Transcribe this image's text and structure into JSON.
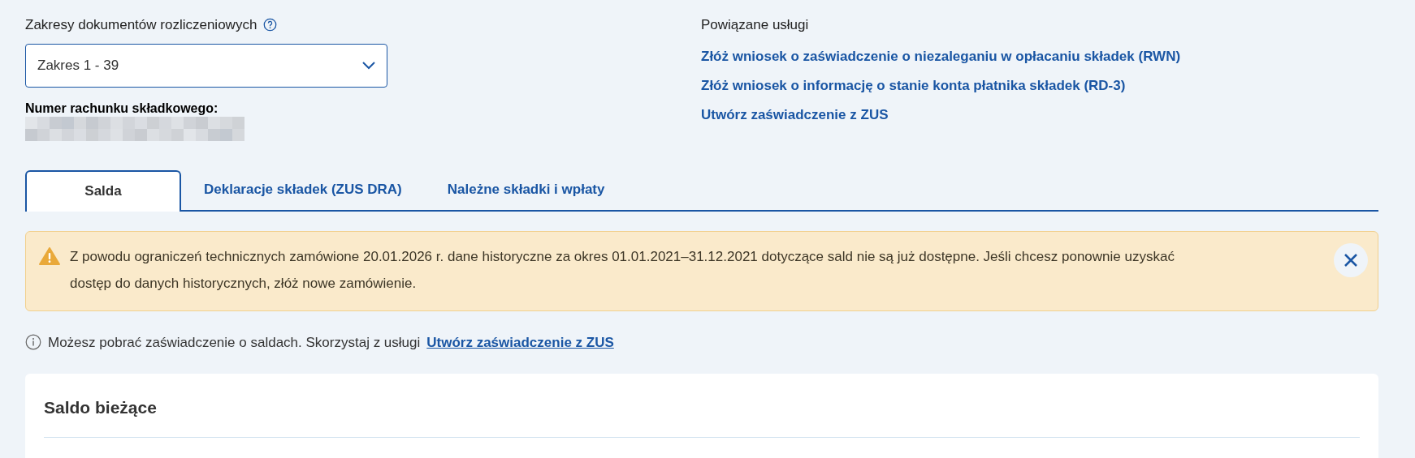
{
  "range_selector": {
    "label": "Zakresy dokumentów rozliczeniowych",
    "value": "Zakres 1 - 39"
  },
  "account": {
    "label": "Numer rachunku składkowego:",
    "redacted": true
  },
  "related_services": {
    "title": "Powiązane usługi",
    "links": [
      "Złóż wniosek o zaświadczenie o niezaleganiu w opłacaniu składek (RWN)",
      "Złóż wniosek o informację o stanie konta płatnika składek (RD-3)",
      "Utwórz zaświadczenie z ZUS"
    ]
  },
  "tabs": [
    {
      "label": "Salda",
      "selected": true
    },
    {
      "label": "Deklaracje składek (ZUS DRA)",
      "selected": false
    },
    {
      "label": "Należne składki i wpłaty",
      "selected": false
    }
  ],
  "alert": {
    "kind": "warning",
    "text": "Z powodu ograniczeń technicznych zamówione 20.01.2026 r. dane historyczne za okres 01.01.2021–31.12.2021 dotyczące sald nie są już dostępne. Jeśli chcesz ponownie uzyskać dostęp do danych historycznych, złóż nowe zamówienie."
  },
  "info": {
    "text": "Możesz pobrać zaświadczenie o saldach. Skorzystaj z usługi",
    "link": "Utwórz zaświadczenie z ZUS"
  },
  "card": {
    "title": "Saldo bieżące"
  }
}
